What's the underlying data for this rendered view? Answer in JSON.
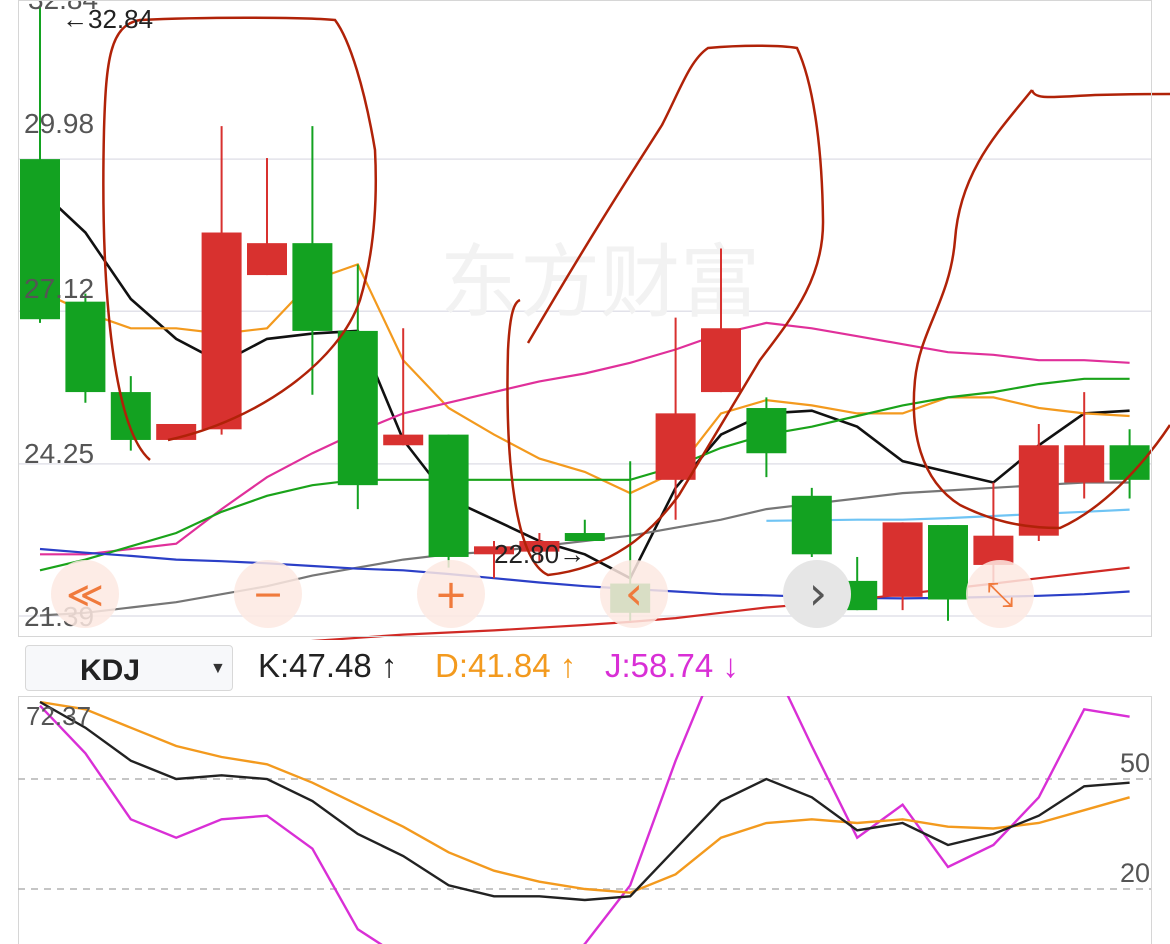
{
  "main_chart": {
    "y_labels": [
      "29.98",
      "27.12",
      "24.25",
      "21.39"
    ],
    "top_value": "32.84",
    "high_marker": "←32.84",
    "low_marker": "22.80→",
    "watermark": "东方财富",
    "colors": {
      "up": "#d8312f",
      "down": "#13a221",
      "ma5": "#111111",
      "ma10": "#f39a1e",
      "ma20": "#e0309a",
      "ma30": "#1aa31a",
      "ma60": "#767676",
      "ma120": "#2b3fc7",
      "ma250": "#d02a25",
      "extra": "#6fc4f4",
      "annotation": "#b02208"
    },
    "nav_buttons": [
      {
        "name": "nav-rewind-button",
        "icon": "double-chevron-left-icon",
        "glyph": "≪"
      },
      {
        "name": "nav-zoom-out-button",
        "icon": "minus-icon",
        "glyph": "−"
      },
      {
        "name": "nav-zoom-in-button",
        "icon": "plus-icon",
        "glyph": "+"
      },
      {
        "name": "nav-prev-button",
        "icon": "chevron-left-icon",
        "glyph": "‹"
      },
      {
        "name": "nav-next-button",
        "icon": "chevron-right-icon",
        "glyph": "›"
      },
      {
        "name": "nav-fullscreen-button",
        "icon": "expand-icon",
        "glyph": "⤡"
      }
    ]
  },
  "indicator_bar": {
    "selector_label": "KDJ",
    "caret": "▼",
    "k_text": "K:47.48 ↑",
    "d_text": "D:41.84 ↑",
    "j_text": "J:58.74 ↓",
    "k_color": "#222222",
    "d_color": "#f39a1e",
    "j_color": "#d92fd6"
  },
  "kdj_panel": {
    "top_label": "72.37",
    "level_labels": [
      "50",
      "20"
    ]
  },
  "chart_data": [
    {
      "type": "candlestick",
      "ylim": [
        21.39,
        32.84
      ],
      "y_ticks": [
        29.98,
        27.12,
        24.25,
        21.39
      ],
      "candles": [
        {
          "open": 29.98,
          "close": 26.97,
          "high": 32.84,
          "low": 26.9
        },
        {
          "open": 27.3,
          "close": 25.6,
          "high": 27.45,
          "low": 25.4
        },
        {
          "open": 25.6,
          "close": 24.7,
          "high": 25.9,
          "low": 24.5
        },
        {
          "open": 24.7,
          "close": 25.0,
          "high": 25.0,
          "low": 24.7
        },
        {
          "open": 24.9,
          "close": 28.6,
          "high": 30.6,
          "low": 24.8
        },
        {
          "open": 27.8,
          "close": 28.4,
          "high": 30.0,
          "low": 27.8
        },
        {
          "open": 28.4,
          "close": 26.75,
          "high": 30.6,
          "low": 25.55
        },
        {
          "open": 26.75,
          "close": 23.85,
          "high": 28.0,
          "low": 23.4
        },
        {
          "open": 24.6,
          "close": 24.8,
          "high": 26.8,
          "low": 24.6
        },
        {
          "open": 24.8,
          "close": 22.5,
          "high": 24.8,
          "low": 22.3
        },
        {
          "open": 22.55,
          "close": 22.7,
          "high": 22.8,
          "low": 22.1
        },
        {
          "open": 22.6,
          "close": 22.8,
          "high": 22.95,
          "low": 22.4
        },
        {
          "open": 22.95,
          "close": 22.8,
          "high": 23.2,
          "low": 22.8
        },
        {
          "open": 22.0,
          "close": 21.45,
          "high": 24.3,
          "low": 21.3
        },
        {
          "open": 23.95,
          "close": 25.2,
          "high": 27.0,
          "low": 23.2
        },
        {
          "open": 25.6,
          "close": 26.8,
          "high": 28.3,
          "low": 25.6
        },
        {
          "open": 25.3,
          "close": 24.45,
          "high": 25.5,
          "low": 24.0
        },
        {
          "open": 23.65,
          "close": 22.55,
          "high": 23.8,
          "low": 22.5
        },
        {
          "open": 22.05,
          "close": 21.5,
          "high": 22.5,
          "low": 21.5
        },
        {
          "open": 21.75,
          "close": 23.15,
          "high": 23.15,
          "low": 21.5
        },
        {
          "open": 23.1,
          "close": 21.7,
          "high": 23.1,
          "low": 21.3
        },
        {
          "open": 22.35,
          "close": 22.9,
          "high": 23.9,
          "low": 21.9
        },
        {
          "open": 22.9,
          "close": 24.6,
          "high": 25.0,
          "low": 22.8
        },
        {
          "open": 23.9,
          "close": 24.6,
          "high": 25.6,
          "low": 23.6
        },
        {
          "open": 24.6,
          "close": 23.95,
          "high": 24.9,
          "low": 23.6
        }
      ],
      "series": [
        {
          "color": "#111111",
          "values": [
            29.4,
            28.6,
            27.35,
            26.6,
            26.15,
            26.6,
            26.7,
            26.75,
            24.7,
            23.6,
            23.2,
            22.8,
            22.55,
            22.1,
            23.8,
            24.8,
            25.2,
            25.25,
            24.95,
            24.3,
            24.1,
            23.9,
            24.6,
            25.2,
            25.25
          ]
        },
        {
          "color": "#f39a1e",
          "values": [
            27.5,
            27.1,
            26.8,
            26.8,
            26.7,
            26.8,
            27.7,
            28.0,
            26.2,
            25.3,
            24.8,
            24.35,
            24.1,
            23.7,
            24.1,
            25.2,
            25.45,
            25.35,
            25.2,
            25.2,
            25.5,
            25.5,
            25.3,
            25.2,
            25.15
          ]
        },
        {
          "color": "#e0309a",
          "values": [
            22.55,
            22.55,
            22.65,
            22.75,
            23.4,
            24.0,
            24.45,
            24.85,
            25.2,
            25.4,
            25.6,
            25.8,
            25.95,
            26.15,
            26.4,
            26.7,
            26.9,
            26.8,
            26.65,
            26.5,
            26.35,
            26.3,
            26.2,
            26.2,
            26.15
          ]
        },
        {
          "color": "#1aa31a",
          "values": [
            22.25,
            22.45,
            22.7,
            22.95,
            23.35,
            23.65,
            23.85,
            23.95,
            23.95,
            23.95,
            23.95,
            23.95,
            23.95,
            23.95,
            24.2,
            24.55,
            24.8,
            24.95,
            25.15,
            25.35,
            25.5,
            25.6,
            25.75,
            25.85,
            25.85
          ]
        },
        {
          "color": "#767676",
          "values": [
            21.4,
            21.45,
            21.55,
            21.65,
            21.8,
            21.95,
            22.15,
            22.3,
            22.45,
            22.55,
            22.6,
            22.7,
            22.8,
            22.9,
            23.05,
            23.2,
            23.4,
            23.5,
            23.6,
            23.7,
            23.75,
            23.8,
            23.85,
            23.9,
            23.9
          ]
        },
        {
          "color": "#2b3fc7",
          "values": [
            22.65,
            22.58,
            22.52,
            22.45,
            22.42,
            22.38,
            22.33,
            22.28,
            22.25,
            22.18,
            22.1,
            22.02,
            21.95,
            21.9,
            21.85,
            21.8,
            21.78,
            21.75,
            21.73,
            21.72,
            21.73,
            21.75,
            21.77,
            21.8,
            21.85
          ]
        },
        {
          "color": "#d02a25",
          "values": [
            20.6,
            20.62,
            20.68,
            20.74,
            20.8,
            20.86,
            20.92,
            20.98,
            21.04,
            21.08,
            21.12,
            21.17,
            21.22,
            21.28,
            21.35,
            21.45,
            21.55,
            21.62,
            21.7,
            21.8,
            21.9,
            22.0,
            22.1,
            22.2,
            22.3
          ]
        }
      ],
      "extra_line": {
        "color": "#6fc4f4",
        "from_index": 16,
        "values": [
          23.18,
          23.19,
          23.2,
          23.2,
          23.23,
          23.27,
          23.31,
          23.35,
          23.39
        ]
      }
    },
    {
      "type": "line",
      "ylim": [
        0,
        72.37
      ],
      "y_ticks": [
        50,
        20
      ],
      "series": [
        {
          "name": "K",
          "color": "#222222",
          "values": [
            71,
            64,
            55,
            50,
            51,
            50,
            44,
            35,
            29,
            21,
            18,
            18,
            17,
            18,
            31,
            44,
            50,
            45,
            36,
            38,
            32,
            35,
            40,
            48,
            49
          ]
        },
        {
          "name": "D",
          "color": "#f39a1e",
          "values": [
            71,
            69,
            64,
            59,
            56,
            54,
            49,
            43,
            37,
            30,
            25,
            22,
            20,
            19,
            24,
            34,
            38,
            39,
            38,
            39,
            37,
            36.5,
            38,
            41.5,
            45
          ]
        },
        {
          "name": "J",
          "color": "#d92fd6",
          "values": [
            70,
            57,
            39,
            34,
            39,
            40,
            31,
            9,
            1,
            -5,
            -5,
            -5,
            5,
            21,
            55,
            85,
            85,
            59,
            34,
            43,
            26,
            32,
            45,
            69,
            67
          ]
        }
      ]
    }
  ]
}
